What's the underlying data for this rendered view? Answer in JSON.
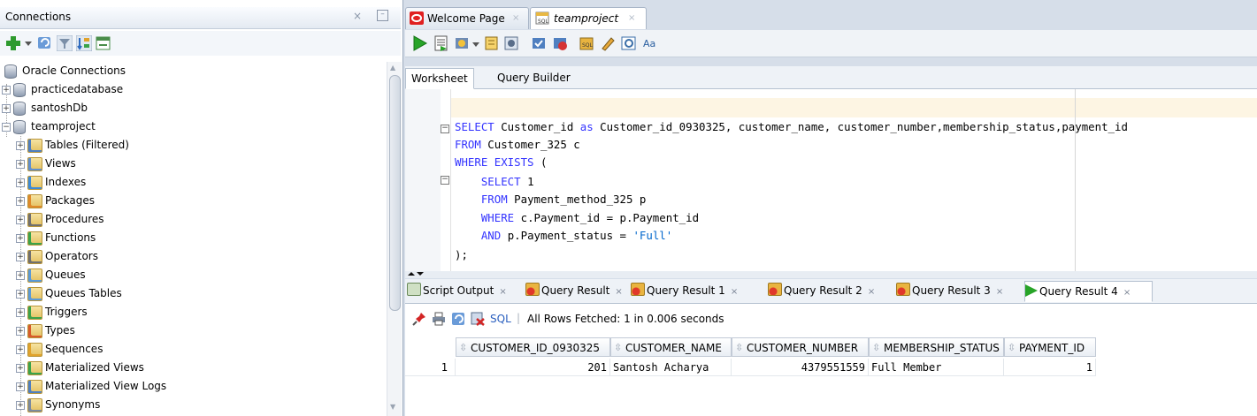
{
  "connections_panel": {
    "title": "Connections",
    "close_glyph": "×",
    "minimize_glyph": "–",
    "toolbar_icons": [
      "add-connection-icon",
      "dropdown-arrow-icon",
      "refresh-icon",
      "filter-icon",
      "schema-browser-icon",
      "collapse-icon"
    ],
    "tree": [
      {
        "label": "Oracle Connections",
        "icon": "database-folder-icon",
        "level": 0,
        "expander": ""
      },
      {
        "label": "practicedatabase",
        "icon": "database-icon",
        "level": 1,
        "expander": "+"
      },
      {
        "label": "santoshDb",
        "icon": "database-icon",
        "level": 1,
        "expander": "+"
      },
      {
        "label": "teamproject",
        "icon": "connection-icon",
        "level": 1,
        "expander": "−"
      },
      {
        "label": "Tables (Filtered)",
        "icon": "tables-icon",
        "level": 2,
        "expander": "+"
      },
      {
        "label": "Views",
        "icon": "views-icon",
        "level": 2,
        "expander": "+"
      },
      {
        "label": "Indexes",
        "icon": "indexes-icon",
        "level": 2,
        "expander": "+"
      },
      {
        "label": "Packages",
        "icon": "packages-icon",
        "level": 2,
        "expander": "+"
      },
      {
        "label": "Procedures",
        "icon": "procedures-icon",
        "level": 2,
        "expander": "+"
      },
      {
        "label": "Functions",
        "icon": "functions-icon",
        "level": 2,
        "expander": "+"
      },
      {
        "label": "Operators",
        "icon": "operators-icon",
        "level": 2,
        "expander": "+"
      },
      {
        "label": "Queues",
        "icon": "queues-icon",
        "level": 2,
        "expander": "+"
      },
      {
        "label": "Queues Tables",
        "icon": "queues-tables-icon",
        "level": 2,
        "expander": "+"
      },
      {
        "label": "Triggers",
        "icon": "triggers-icon",
        "level": 2,
        "expander": "+"
      },
      {
        "label": "Types",
        "icon": "types-icon",
        "level": 2,
        "expander": "+"
      },
      {
        "label": "Sequences",
        "icon": "sequences-icon",
        "level": 2,
        "expander": "+"
      },
      {
        "label": "Materialized Views",
        "icon": "materialized-views-icon",
        "level": 2,
        "expander": "+"
      },
      {
        "label": "Materialized View Logs",
        "icon": "materialized-view-logs-icon",
        "level": 2,
        "expander": "+"
      },
      {
        "label": "Synonyms",
        "icon": "synonyms-icon",
        "level": 2,
        "expander": "+"
      }
    ]
  },
  "doc_tabs": [
    {
      "label": "Welcome Page",
      "close": "×",
      "icon": "oracle-logo-icon"
    },
    {
      "label": "teamproject",
      "close": "×",
      "icon": "sql-worksheet-icon"
    }
  ],
  "sql_toolbar_icons": [
    "run-statement-icon",
    "run-script-icon",
    "autotrace-icon",
    "dropdown-arrow-icon",
    "explain-plan-icon",
    "sql-tuning-icon",
    "commit-icon",
    "rollback-icon",
    "unshared-worksheet-icon",
    "clear-icon",
    "history-icon",
    "format-icon"
  ],
  "worksheet_tabs": [
    "Worksheet",
    "Query Builder"
  ],
  "editor": {
    "fold_open_glyph": "−",
    "lines": [
      {
        "segments": [
          {
            "t": "SELECT",
            "k": "kw"
          },
          {
            "t": " Customer_id ",
            "k": ""
          },
          {
            "t": "as",
            "k": "kw"
          },
          {
            "t": " Customer_id_0930325, customer_name, customer_number,membership_status,payment_id",
            "k": ""
          }
        ]
      },
      {
        "segments": [
          {
            "t": "FROM",
            "k": "kw"
          },
          {
            "t": " Customer_325 c",
            "k": ""
          }
        ]
      },
      {
        "segments": [
          {
            "t": "WHERE EXISTS",
            "k": "kw"
          },
          {
            "t": " (",
            "k": ""
          }
        ]
      },
      {
        "segments": [
          {
            "t": "    ",
            "k": ""
          },
          {
            "t": "SELECT",
            "k": "kw"
          },
          {
            "t": " 1",
            "k": ""
          }
        ]
      },
      {
        "segments": [
          {
            "t": "    ",
            "k": ""
          },
          {
            "t": "FROM",
            "k": "kw"
          },
          {
            "t": " Payment_method_325 p",
            "k": ""
          }
        ]
      },
      {
        "segments": [
          {
            "t": "    ",
            "k": ""
          },
          {
            "t": "WHERE",
            "k": "kw"
          },
          {
            "t": " c.Payment_id = p.Payment_id",
            "k": ""
          }
        ]
      },
      {
        "segments": [
          {
            "t": "    ",
            "k": ""
          },
          {
            "t": "AND",
            "k": "kw"
          },
          {
            "t": " p.Payment_status = ",
            "k": ""
          },
          {
            "t": "'Full'",
            "k": "str"
          }
        ]
      },
      {
        "segments": [
          {
            "t": ");",
            "k": ""
          }
        ]
      }
    ]
  },
  "result_tabs": [
    {
      "label": "Script Output",
      "close": "×",
      "icon": "script-output-icon"
    },
    {
      "label": "Query Result",
      "close": "×",
      "icon": "query-result-icon"
    },
    {
      "label": "Query Result 1",
      "close": "×",
      "icon": "query-result-icon"
    },
    {
      "label": "Query Result 2",
      "close": "×",
      "icon": "query-result-icon"
    },
    {
      "label": "Query Result 3",
      "close": "×",
      "icon": "query-result-icon"
    },
    {
      "label": "Query Result 4",
      "close": "×",
      "icon": "run-statement-icon"
    }
  ],
  "result_toolbar": {
    "sql_label": "SQL",
    "status": "All Rows Fetched: 1 in 0.006 seconds"
  },
  "grid": {
    "sort_glyph": "⇳",
    "columns": [
      "CUSTOMER_ID_0930325",
      "CUSTOMER_NAME",
      "CUSTOMER_NUMBER",
      "MEMBERSHIP_STATUS",
      "PAYMENT_ID"
    ],
    "rows": [
      {
        "row_num": "1",
        "cells": [
          "201",
          "Santosh Acharya",
          "4379551559",
          "Full Member",
          "1"
        ]
      }
    ]
  },
  "colors": {
    "keyword": "#3333ff",
    "string": "#0066cc",
    "selection_bg": "#fdf5e3",
    "panel_bg": "#d6dee9"
  }
}
